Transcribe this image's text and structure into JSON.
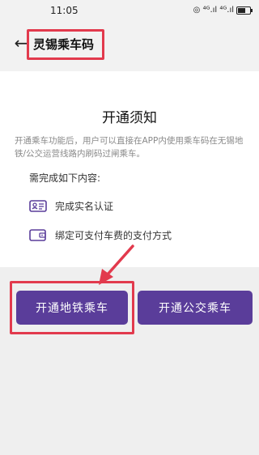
{
  "status_bar": {
    "time": "11:05",
    "icons": "◎ ⁴ᴳ.ıl ⁴ᴳ.ıl"
  },
  "app_bar": {
    "back_icon": "←",
    "title": "灵锡乘车码"
  },
  "notice": {
    "title": "开通须知",
    "description": "开通乘车功能后，用户可以直接在APP内使用乘车码在无锡地铁/公交运营线路内刷码过闸乘车。",
    "requirements_heading": "需完成如下内容:",
    "requirements": [
      {
        "icon": "id-card-icon",
        "label": "完成实名认证"
      },
      {
        "icon": "wallet-icon",
        "label": "绑定可支付车费的支付方式"
      }
    ]
  },
  "buttons": {
    "metro_label": "开通地铁乘车",
    "bus_label": "开通公交乘车"
  },
  "colors": {
    "accent": "#5a3d9a",
    "highlight": "#e23a4d",
    "background": "#f2f2f2"
  }
}
